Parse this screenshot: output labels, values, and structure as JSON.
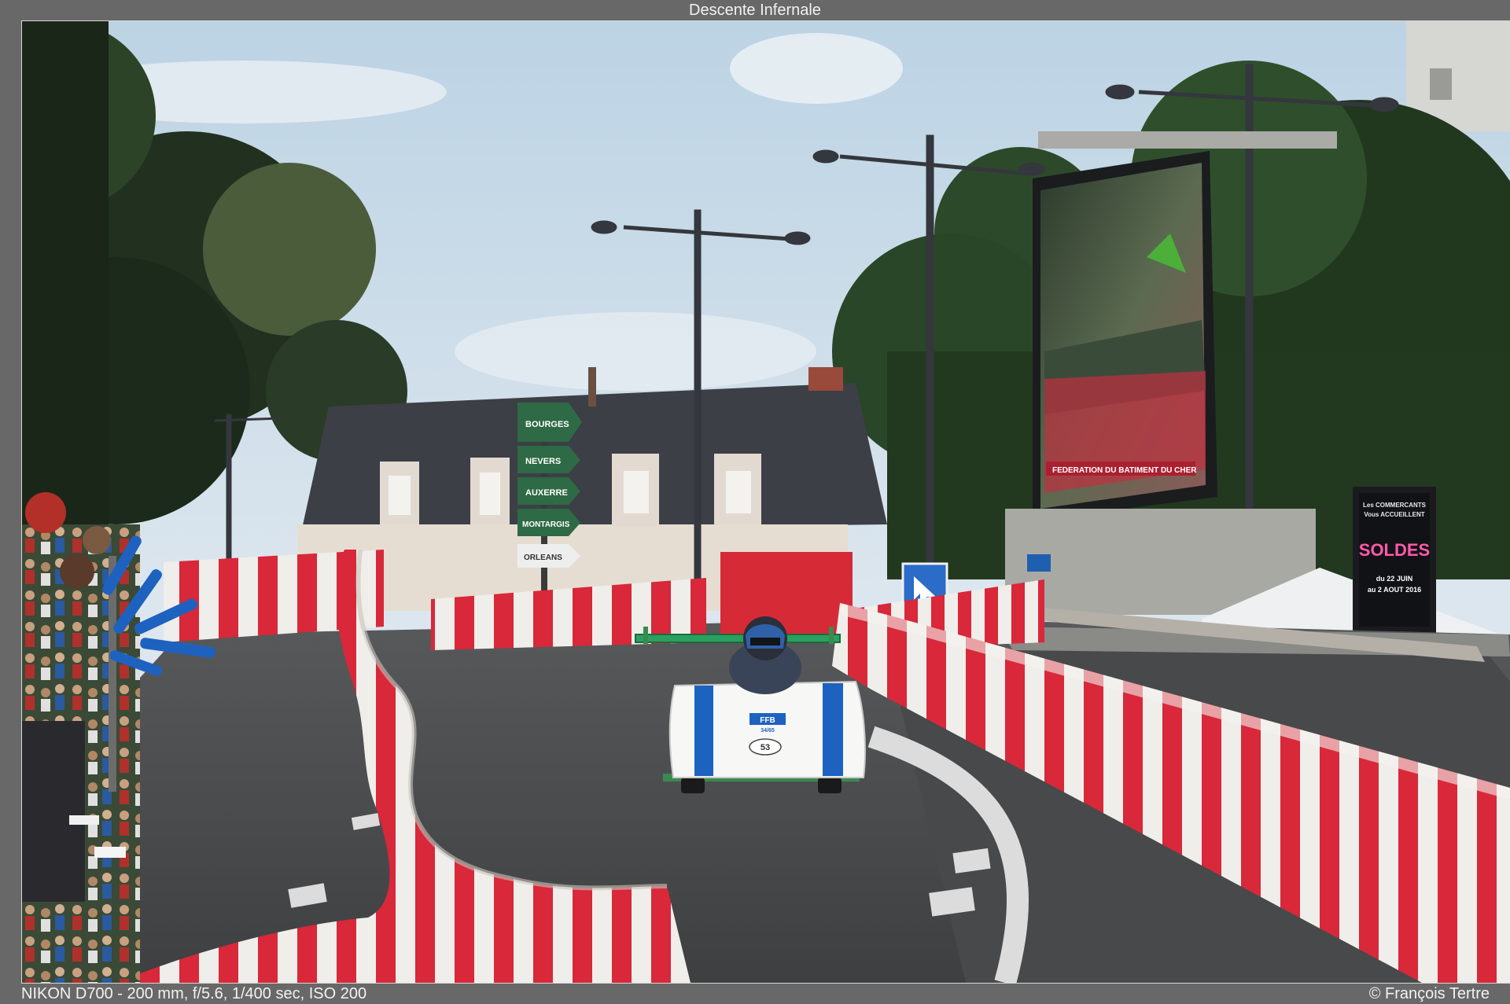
{
  "title": "Descente Infernale",
  "exif": "NIKON D700 - 200 mm, f/5.6, 1/400 sec, ISO 200",
  "credit": "© François Tertre",
  "photo": {
    "kart_brand": "FFB",
    "kart_brand_sub": "34/65",
    "kart_number": "53",
    "billboard_line1": "Les COMMERCANTS",
    "billboard_line2": "Vous ACCUEILLENT",
    "billboard_main": "SOLDES",
    "billboard_date1": "du 22 JUIN",
    "billboard_date2": "au 2 AOUT 2016",
    "screen_banner": "FEDERATION DU BATIMENT DU CHER",
    "sign_1": "BOURGES",
    "sign_2": "NEVERS",
    "sign_3": "AUXERRE",
    "sign_4": "MONTARGIS",
    "sign_5": "ORLEANS"
  },
  "colors": {
    "barrier_red": "#d8283a",
    "barrier_white": "#efeeea",
    "sky": "#d2e1ec",
    "asphalt": "#4a4b4d",
    "kart_blue": "#1e62c0",
    "foliage": "#243a22"
  }
}
